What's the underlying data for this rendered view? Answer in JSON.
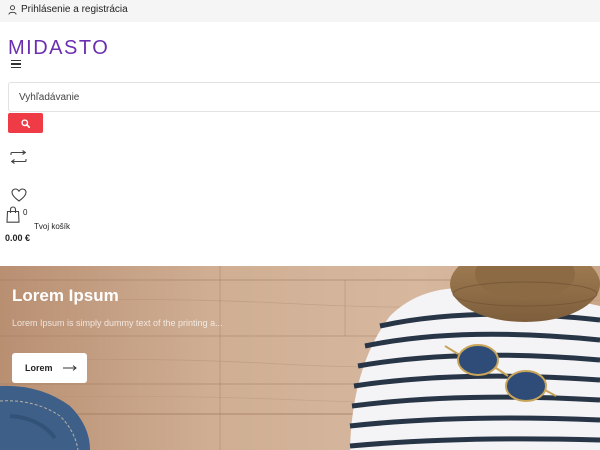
{
  "topbar": {
    "login_label": "Prihlásenie a registrácia",
    "user_icon": "user-icon"
  },
  "header": {
    "logo_text": "MIDASTO",
    "logo_color": "#6b2fb0",
    "menu_icon": "hamburger-menu-icon"
  },
  "search": {
    "placeholder": "Vyhľadávanie",
    "button_icon": "search-icon",
    "button_color": "#ef3b46"
  },
  "actions": {
    "compare_icon": "compare-arrows-icon",
    "wishlist_icon": "heart-icon",
    "cart_icon": "shopping-bag-icon"
  },
  "cart": {
    "count": "0",
    "label": "Tvoj košík",
    "total": "0.00 €"
  },
  "hero": {
    "title": "Lorem Ipsum",
    "subtitle": "Lorem Ipsum is simply dummy text of the printing a...",
    "button_label": "Lorem",
    "button_icon": "arrow-right-icon"
  }
}
